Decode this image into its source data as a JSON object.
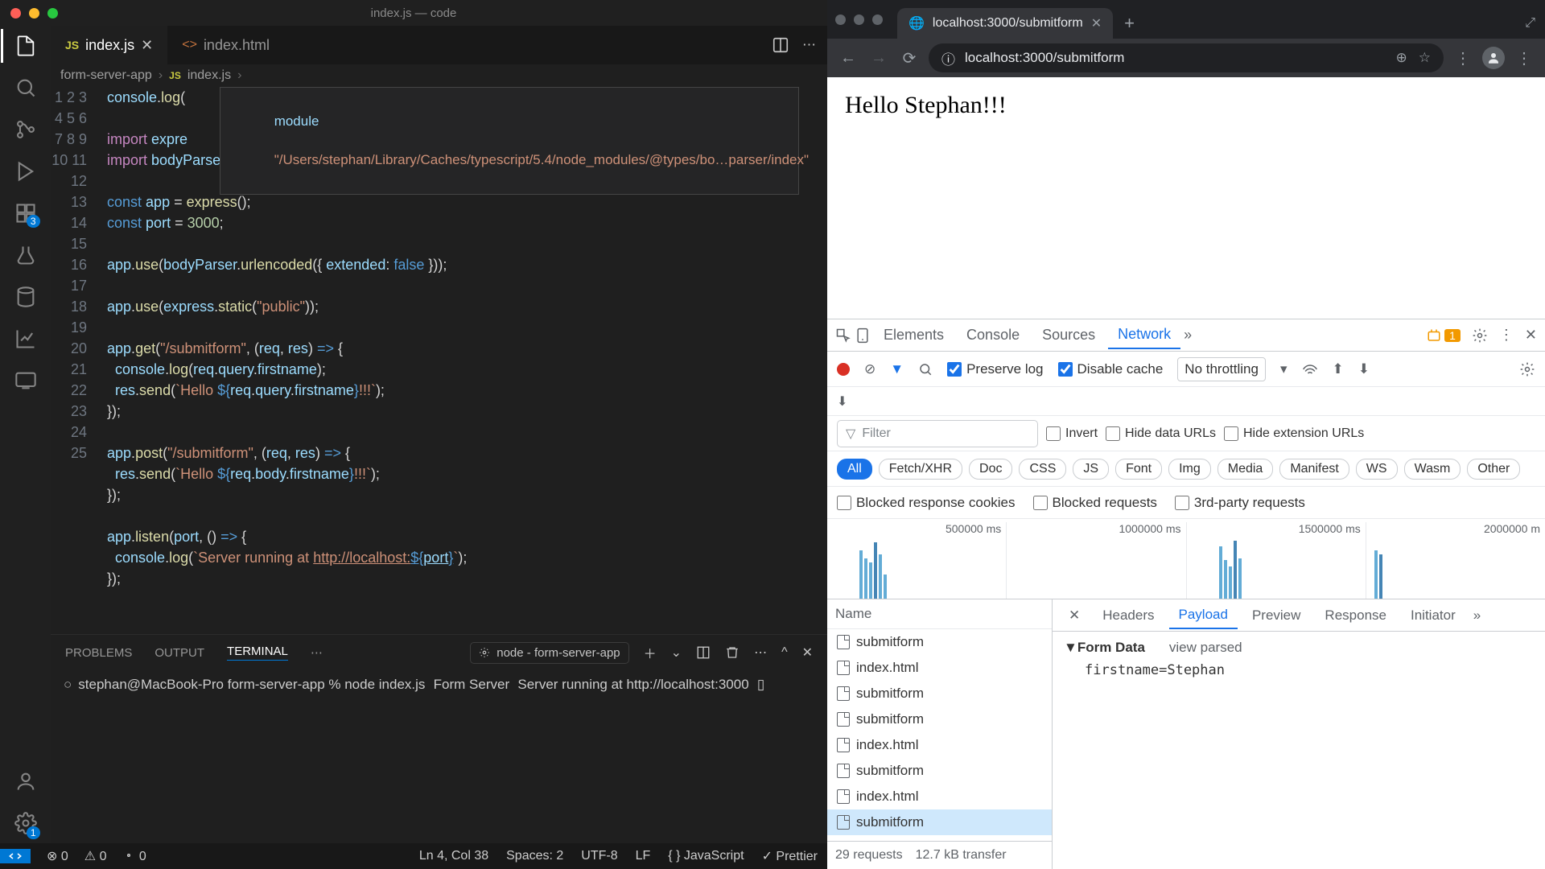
{
  "vscode": {
    "title": "index.js — code",
    "tabs": [
      {
        "icon": "JS",
        "label": "index.js",
        "active": true
      },
      {
        "icon": "<>",
        "label": "index.html",
        "active": false
      }
    ],
    "breadcrumbs": [
      "form-server-app",
      "index.js"
    ],
    "badge_scm": "3",
    "hover": {
      "keyword": "module",
      "path": "\"/Users/stephan/Library/Caches/typescript/5.4/node_modules/@types/bo…parser/index\""
    },
    "code_lines": [
      "console.log(",
      "",
      "import expre",
      "import bodyParser from \"body-parser\";",
      "",
      "const app = express();",
      "const port = 3000;",
      "",
      "app.use(bodyParser.urlencoded({ extended: false }));",
      "",
      "app.use(express.static(\"public\"));",
      "",
      "app.get(\"/submitform\", (req, res) => {",
      "  console.log(req.query.firstname);",
      "  res.send(`Hello ${req.query.firstname}!!!`);",
      "});",
      "",
      "app.post(\"/submitform\", (req, res) => {",
      "  res.send(`Hello ${req.body.firstname}!!!`);",
      "});",
      "",
      "app.listen(port, () => {",
      "  console.log(`Server running at http://localhost:${port}`);",
      "});",
      ""
    ],
    "panel_tabs": [
      "PROBLEMS",
      "OUTPUT",
      "TERMINAL"
    ],
    "task": "node - form-server-app",
    "terminal": [
      "stephan@MacBook-Pro form-server-app % node index.js",
      "Form Server",
      "Server running at http://localhost:3000",
      "▯"
    ],
    "status": {
      "errors": "0",
      "warnings": "0",
      "ports": "0",
      "cursor": "Ln 4, Col 38",
      "spaces": "Spaces: 2",
      "encoding": "UTF-8",
      "eol": "LF",
      "lang": "JavaScript",
      "prettier": "Prettier"
    }
  },
  "chrome": {
    "tab_title": "localhost:3000/submitform",
    "url": "localhost:3000/submitform",
    "page_heading": "Hello Stephan!!!",
    "devtools": {
      "tabs": [
        "Elements",
        "Console",
        "Sources",
        "Network"
      ],
      "issues_count": "1",
      "preserve_log": "Preserve log",
      "disable_cache": "Disable cache",
      "throttling": "No throttling",
      "filter_placeholder": "Filter",
      "invert": "Invert",
      "hide_urls": "Hide data URLs",
      "hide_ext": "Hide extension URLs",
      "types": [
        "All",
        "Fetch/XHR",
        "Doc",
        "CSS",
        "JS",
        "Font",
        "Img",
        "Media",
        "Manifest",
        "WS",
        "Wasm",
        "Other"
      ],
      "blocked_cookies": "Blocked response cookies",
      "blocked_req": "Blocked requests",
      "third_party": "3rd-party requests",
      "timeline": [
        "500000 ms",
        "1000000 ms",
        "1500000 ms",
        "2000000 m"
      ],
      "name_header": "Name",
      "requests": [
        "submitform",
        "index.html",
        "submitform",
        "submitform",
        "index.html",
        "submitform",
        "index.html",
        "submitform"
      ],
      "footer_requests": "29 requests",
      "footer_transfer": "12.7 kB transfer",
      "detail_tabs": [
        "Headers",
        "Payload",
        "Preview",
        "Response",
        "Initiator"
      ],
      "form_data": "Form Data",
      "view_parsed": "view parsed",
      "form_row": "firstname=Stephan"
    }
  }
}
